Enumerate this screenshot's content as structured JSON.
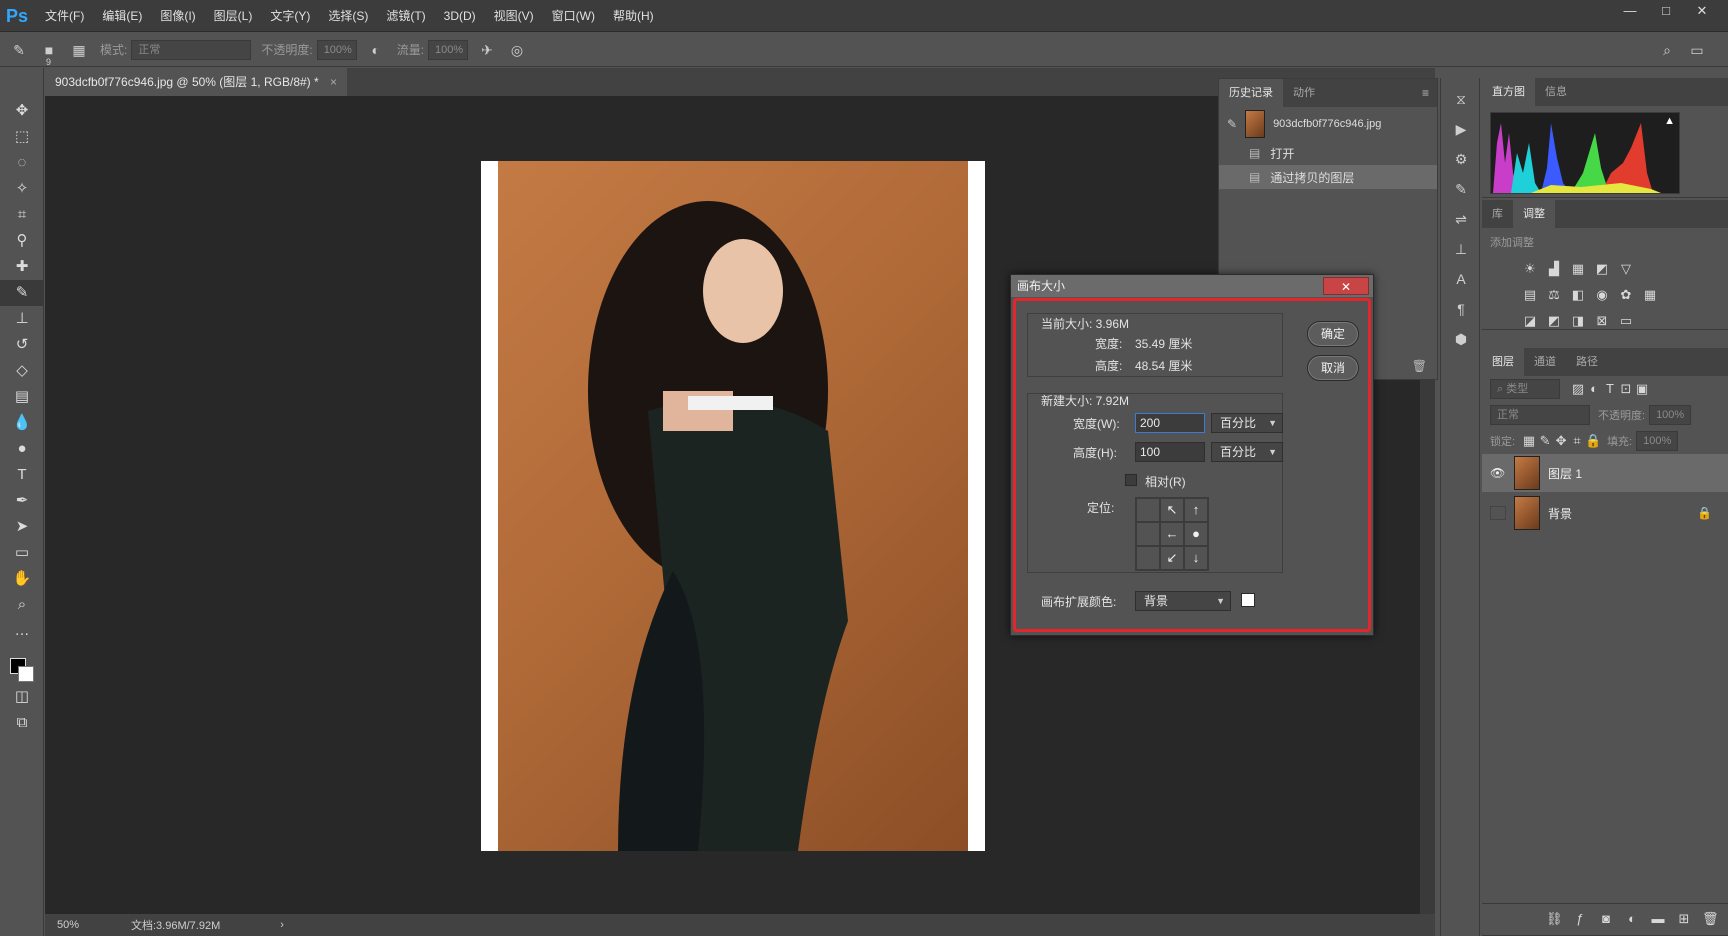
{
  "app": {
    "logo": "Ps"
  },
  "menubar": {
    "items": [
      "文件(F)",
      "编辑(E)",
      "图像(I)",
      "图层(L)",
      "文字(Y)",
      "选择(S)",
      "滤镜(T)",
      "3D(D)",
      "视图(V)",
      "窗口(W)",
      "帮助(H)"
    ],
    "window_controls": [
      "—",
      "□",
      "✕"
    ]
  },
  "optbar": {
    "brush_size": "9",
    "mode_label": "模式:",
    "mode_value": "正常",
    "opacity_label": "不透明度:",
    "opacity_value": "100%",
    "flow_label": "流量:",
    "flow_value": "100%"
  },
  "document": {
    "tab_title": "903dcfb0f776c946.jpg @ 50% (图层 1, RGB/8#) *",
    "tab_close": "×",
    "zoom": "50%",
    "doc_size": "文档:3.96M/7.92M",
    "status_arrow": "›"
  },
  "history_panel": {
    "tabs": [
      "历史记录",
      "动作"
    ],
    "snapshot_name": "903dcfb0f776c946.jpg",
    "entries": [
      "打开",
      "通过拷贝的图层"
    ]
  },
  "right_panels": {
    "top_tabs": [
      "直方图",
      "信息"
    ],
    "mid_tabs": [
      "库",
      "调整"
    ],
    "adjust_hint": "添加调整",
    "layers_tabs": [
      "图层",
      "通道",
      "路径"
    ],
    "filter_kind": "类型",
    "blend_mode": "正常",
    "opacity_label": "不透明度:",
    "opacity_value": "100%",
    "lock_label": "锁定:",
    "fill_label": "填充:",
    "fill_value": "100%",
    "layers": [
      {
        "name": "图层 1",
        "visible": true,
        "selected": true
      },
      {
        "name": "背景",
        "visible": false,
        "locked": true
      }
    ]
  },
  "dialog": {
    "title": "画布大小",
    "close": "✕",
    "current_size_label": "当前大小: 3.96M",
    "current_width_label": "宽度:",
    "current_width_value": "35.49 厘米",
    "current_height_label": "高度:",
    "current_height_value": "48.54 厘米",
    "new_size_label": "新建大小: 7.92M",
    "width_label": "宽度(W):",
    "width_value": "200",
    "width_unit": "百分比",
    "height_label": "高度(H):",
    "height_value": "100",
    "height_unit": "百分比",
    "relative_label": "相对(R)",
    "relative_checked": false,
    "anchor_label": "定位:",
    "anchor_cells": [
      "",
      "↖",
      "↑",
      "",
      "←",
      "●",
      "",
      "↙",
      "↓"
    ],
    "extension_color_label": "画布扩展颜色:",
    "extension_color_value": "背景",
    "ok_button": "确定",
    "cancel_button": "取消"
  },
  "colors": {
    "accent_red": "#e3262b",
    "ps_blue": "#31a8ff",
    "photo_bg": "#b06a38"
  }
}
